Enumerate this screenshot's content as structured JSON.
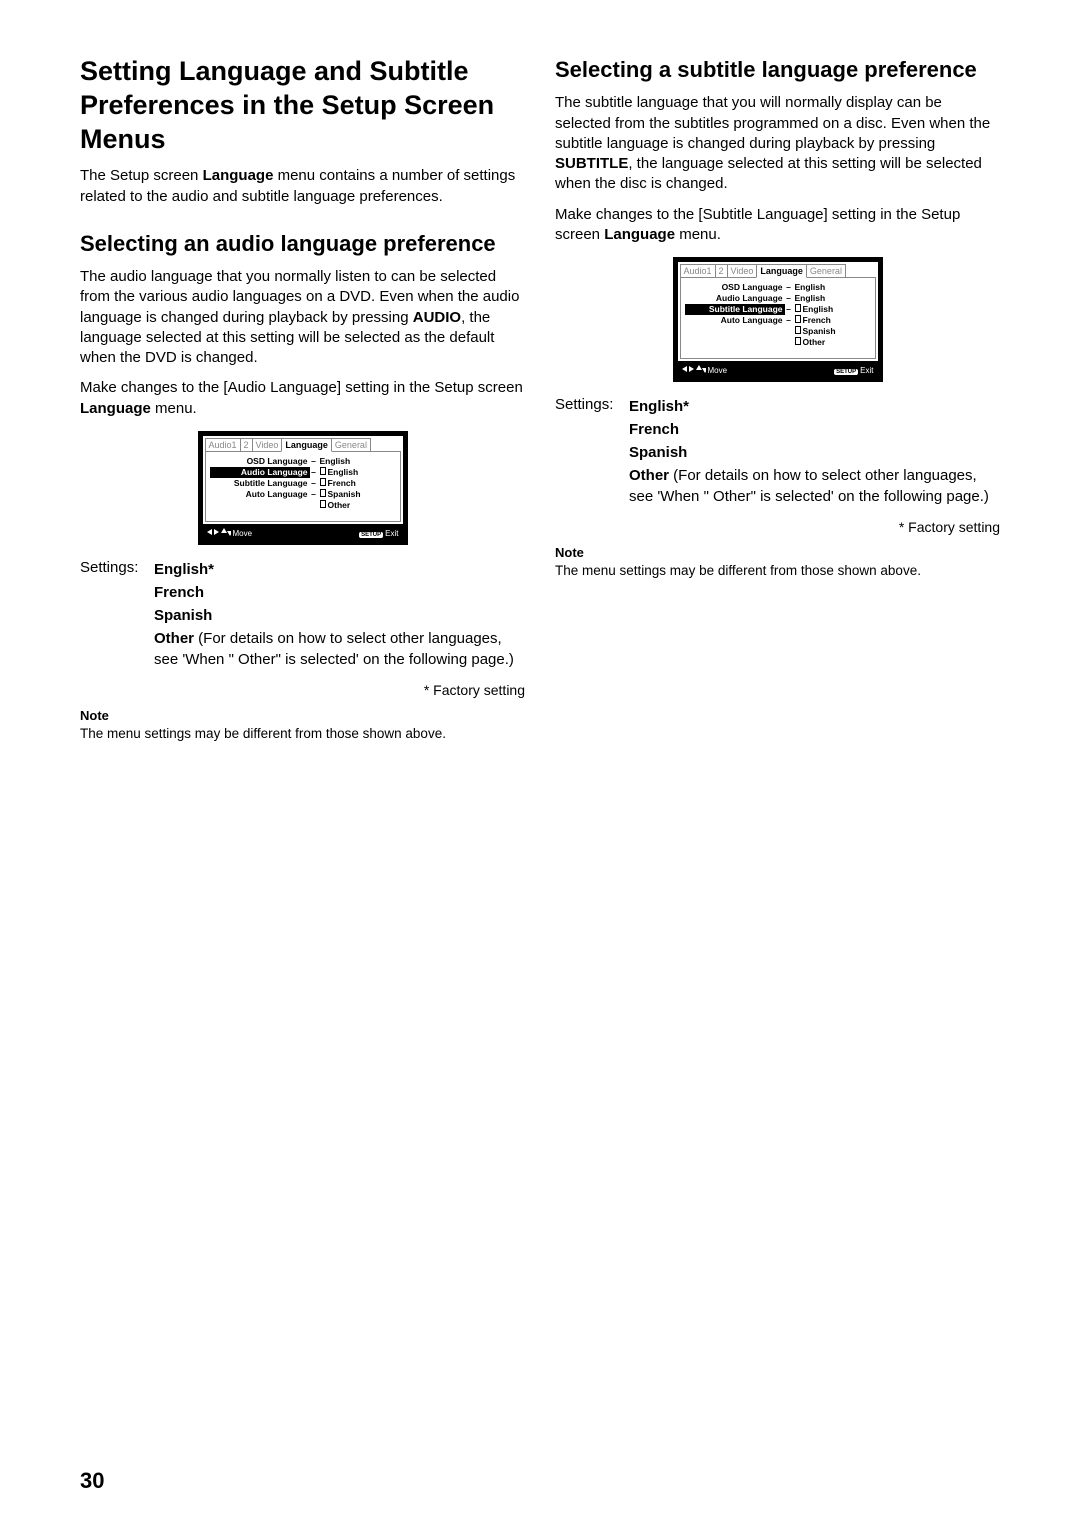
{
  "page_number": "30",
  "left": {
    "h1": "Setting Language and Subtitle Preferences in the Setup Screen Menus",
    "intro_a": "The Setup screen ",
    "intro_b": "Language",
    "intro_c": " menu contains a number of settings related to the audio and subtitle language preferences.",
    "h2": "Selecting an audio language preference",
    "p1_a": "The audio language that you normally listen to can be selected from the various audio languages on a DVD. Even when the audio language is changed during playback by pressing ",
    "p1_b": "AUDIO",
    "p1_c": ", the language selected at this setting will be selected as the default when the DVD is changed.",
    "p2_a": "Make changes to the [Audio Language] setting in the Setup screen ",
    "p2_b": "Language",
    "p2_c": " menu.",
    "settings_label": "Settings:",
    "opt1": "English*",
    "opt2": "French",
    "opt3": "Spanish",
    "opt4_a": "Other",
    "opt4_b": " (For details on how to select other languages, see 'When \" Other\" is selected' on the following page.)",
    "footnote": "* Factory setting",
    "note_label": "Note",
    "note_text": "The menu settings may be different from those shown above."
  },
  "right": {
    "h2": "Selecting a subtitle language preference",
    "p1_a": "The subtitle language that you will normally display can be selected from the subtitles programmed on a disc. Even when the subtitle language is changed during playback by pressing ",
    "p1_b": "SUBTITLE",
    "p1_c": ", the language selected at this setting will be selected when the disc is changed.",
    "p2_a": "Make changes to the [Subtitle Language] setting in the Setup screen ",
    "p2_b": "Language",
    "p2_c": " menu.",
    "settings_label": "Settings:",
    "opt1": "English*",
    "opt2": "French",
    "opt3": "Spanish",
    "opt4_a": "Other",
    "opt4_b": " (For details on how to select other languages, see 'When \" Other\" is selected' on the following page.)",
    "footnote": "* Factory setting",
    "note_label": "Note",
    "note_text": "The menu settings may be different from those shown above."
  },
  "setup_screen": {
    "tabs": {
      "t1": "Audio1",
      "t2": "2",
      "t3": "Video",
      "t4": "Language",
      "t5": "General"
    },
    "rows": {
      "r1l": "OSD Language",
      "r1r": "English",
      "r2l": "Audio Language",
      "r2r": "English",
      "r3l": "Subtitle Language",
      "r3r": "English",
      "r4l": "Auto Language",
      "o1": "English",
      "o2": "French",
      "o3": "Spanish",
      "o4": "Other"
    },
    "nav_move": "Move",
    "nav_setup": "SETUP",
    "nav_exit": "Exit"
  }
}
